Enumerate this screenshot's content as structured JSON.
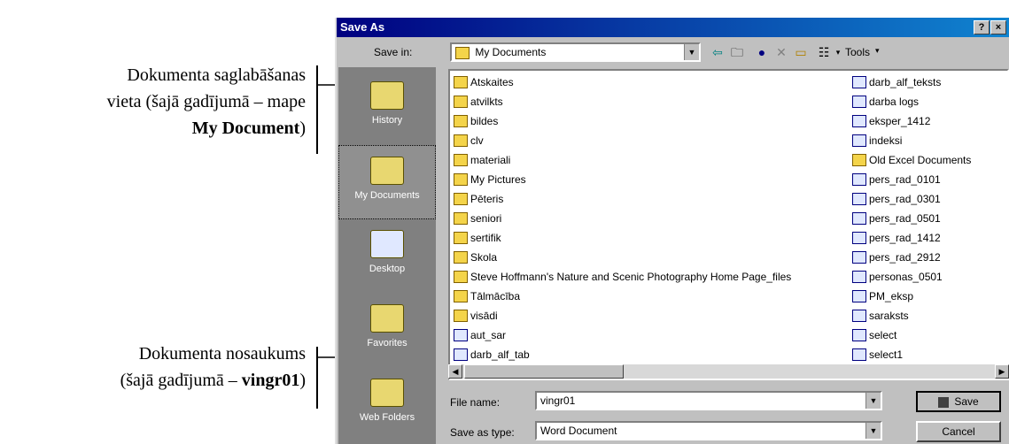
{
  "annotations": {
    "location": {
      "line1": "Dokumenta saglabāšanas",
      "line2": "vieta (šajā gadījumā – mape",
      "line3_bold": "My Document",
      "line3_close": ")"
    },
    "filename": {
      "line1": "Dokumenta nosaukums",
      "line2_prefix": "(šajā gadījumā – ",
      "line2_bold": "vingr01",
      "line2_suffix": ")"
    }
  },
  "dialog": {
    "title": "Save As",
    "help_glyph": "?",
    "close_glyph": "×",
    "save_in_label": "Save in:",
    "save_in_value": "My Documents",
    "tools_label": "Tools",
    "places": [
      {
        "label": "History"
      },
      {
        "label": "My Documents"
      },
      {
        "label": "Desktop"
      },
      {
        "label": "Favorites"
      },
      {
        "label": "Web Folders"
      }
    ],
    "files_left": [
      {
        "name": "Atskaites",
        "type": "folder"
      },
      {
        "name": "atvilkts",
        "type": "folder"
      },
      {
        "name": "bildes",
        "type": "folder"
      },
      {
        "name": "clv",
        "type": "folder"
      },
      {
        "name": "materiali",
        "type": "folder"
      },
      {
        "name": "My Pictures",
        "type": "folder"
      },
      {
        "name": "Pēteris",
        "type": "folder"
      },
      {
        "name": "seniori",
        "type": "folder"
      },
      {
        "name": "sertifik",
        "type": "folder"
      },
      {
        "name": "Skola",
        "type": "folder"
      },
      {
        "name": "Steve Hoffmann's Nature and Scenic Photography Home Page_files",
        "type": "folder"
      },
      {
        "name": "Tālmācība",
        "type": "folder"
      },
      {
        "name": "visādi",
        "type": "folder"
      },
      {
        "name": "aut_sar",
        "type": "doc"
      },
      {
        "name": "darb_alf_tab",
        "type": "doc"
      }
    ],
    "files_right": [
      {
        "name": "darb_alf_teksts",
        "type": "doc"
      },
      {
        "name": "darba logs",
        "type": "doc"
      },
      {
        "name": "eksper_1412",
        "type": "doc"
      },
      {
        "name": "indeksi",
        "type": "doc"
      },
      {
        "name": "Old Excel Documents",
        "type": "folder"
      },
      {
        "name": "pers_rad_0101",
        "type": "doc"
      },
      {
        "name": "pers_rad_0301",
        "type": "doc"
      },
      {
        "name": "pers_rad_0501",
        "type": "doc"
      },
      {
        "name": "pers_rad_1412",
        "type": "doc"
      },
      {
        "name": "pers_rad_2912",
        "type": "doc"
      },
      {
        "name": "personas_0501",
        "type": "doc"
      },
      {
        "name": "PM_eksp",
        "type": "doc"
      },
      {
        "name": "saraksts",
        "type": "doc"
      },
      {
        "name": "select",
        "type": "doc"
      },
      {
        "name": "select1",
        "type": "doc"
      }
    ],
    "file_name_label": "File name:",
    "file_name_value": "vingr01",
    "save_type_label": "Save as type:",
    "save_type_value": "Word Document",
    "save_button": "Save",
    "cancel_button": "Cancel"
  }
}
